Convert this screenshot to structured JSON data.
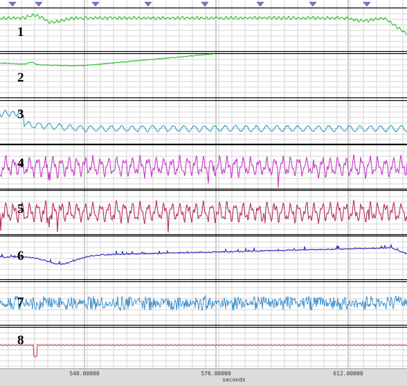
{
  "app": {
    "title": ""
  },
  "channels": [
    {
      "label": "1",
      "color": "#22bb22",
      "kind": "slow"
    },
    {
      "label": "2",
      "color": "#22bb22",
      "kind": "partial"
    },
    {
      "label": "3",
      "color": "#2e9ec4",
      "kind": "resp"
    },
    {
      "label": "4",
      "color": "#c438c4",
      "kind": "pulse"
    },
    {
      "label": "5",
      "color": "#b52a5a",
      "kind": "pulse"
    },
    {
      "label": "6",
      "color": "#2626b8",
      "kind": "drift"
    },
    {
      "label": "7",
      "color": "#1e7fc6",
      "kind": "noise"
    },
    {
      "label": "8",
      "color": "#dd3333",
      "kind": "flat"
    }
  ],
  "time_axis": {
    "unit": "seconds",
    "ticks": [
      {
        "label": "540.00000"
      },
      {
        "label": "576.00000"
      },
      {
        "label": "612.00000"
      }
    ]
  },
  "markers": {
    "count": 8,
    "color": "#7777cc"
  },
  "colors": {
    "grid": "#d6d6d6",
    "grid_major": "#999999",
    "separator": "#000000",
    "axis_bg": "#dcdcdc"
  }
}
